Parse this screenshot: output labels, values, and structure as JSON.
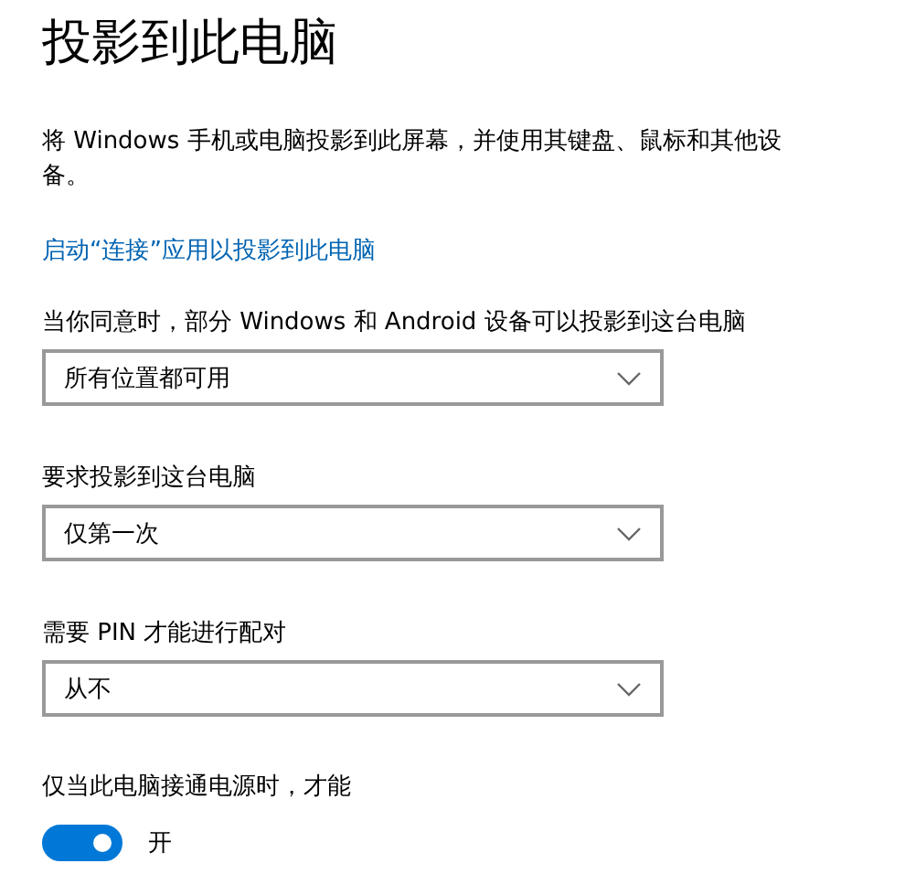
{
  "title": "投影到此电脑",
  "description": "将 Windows 手机或电脑投影到此屏幕，并使用其键盘、鼠标和其他设备。",
  "link": "启动“连接”应用以投影到此电脑",
  "settings": [
    {
      "kind": "dropdown",
      "label": "当你同意时，部分 Windows 和 Android 设备可以投影到这台电脑",
      "value": "所有位置都可用"
    },
    {
      "kind": "dropdown",
      "label": "要求投影到这台电脑",
      "value": "仅第一次"
    },
    {
      "kind": "dropdown",
      "label": "需要 PIN 才能进行配对",
      "value": "从不"
    },
    {
      "kind": "toggle",
      "label": "仅当此电脑接通电源时，才能",
      "on": true,
      "state_text": "开"
    }
  ]
}
